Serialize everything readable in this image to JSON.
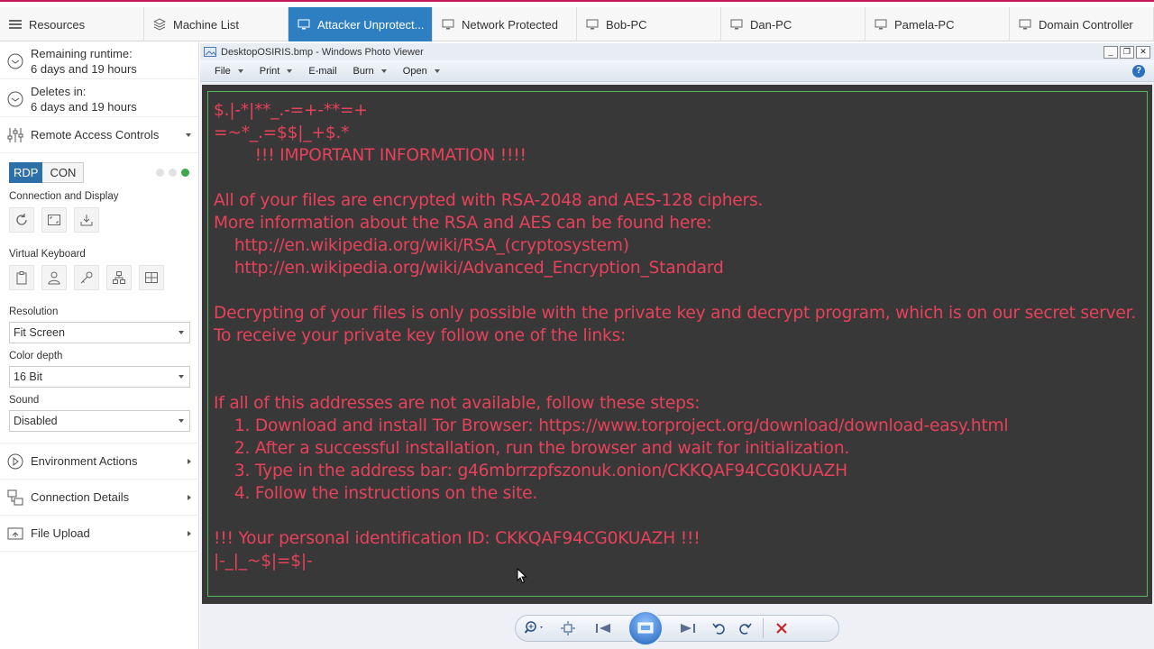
{
  "tabs": [
    {
      "label": "Resources"
    },
    {
      "label": "Machine List"
    },
    {
      "label": "Attacker Unprotect..."
    },
    {
      "label": "Network Protected"
    },
    {
      "label": "Bob-PC"
    },
    {
      "label": "Dan-PC"
    },
    {
      "label": "Pamela-PC"
    },
    {
      "label": "Domain Controller"
    }
  ],
  "sidebar": {
    "remaining_label": "Remaining runtime:",
    "remaining_value": "6 days and 19 hours",
    "deletes_label": "Deletes in:",
    "deletes_value": "6 days and 19 hours",
    "remote_access": "Remote Access Controls",
    "rdp": "RDP",
    "con": "CON",
    "connection_display": "Connection and Display",
    "virtual_keyboard": "Virtual Keyboard",
    "resolution_label": "Resolution",
    "resolution_value": "Fit Screen",
    "color_depth_label": "Color depth",
    "color_depth_value": "16 Bit",
    "sound_label": "Sound",
    "sound_value": "Disabled",
    "environment_actions": "Environment Actions",
    "connection_details": "Connection Details",
    "file_upload": "File Upload"
  },
  "viewer": {
    "title": "DesktopOSIRIS.bmp - Windows Photo Viewer",
    "menu": {
      "file": "File",
      "print": "Print",
      "email": "E-mail",
      "burn": "Burn",
      "open": "Open"
    },
    "help": "?"
  },
  "note": {
    "line1": "$.|-*|**_.-=+-**=+",
    "line2": "=~*_.=$$|_+$.*",
    "line3": "        !!! IMPORTANT INFORMATION !!!!",
    "line4": "",
    "line5": "All of your files are encrypted with RSA-2048 and AES-128 ciphers.",
    "line6": "More information about the RSA and AES can be found here:",
    "line7": "    http://en.wikipedia.org/wiki/RSA_(cryptosystem)",
    "line8": "    http://en.wikipedia.org/wiki/Advanced_Encryption_Standard",
    "line9": "",
    "line10": "Decrypting of your files is only possible with the private key and decrypt program, which is on our secret server.",
    "line11": "To receive your private key follow one of the links:",
    "line12": "",
    "line13": "",
    "line14": "If all of this addresses are not available, follow these steps:",
    "line15": "    1. Download and install Tor Browser: https://www.torproject.org/download/download-easy.html",
    "line16": "    2. After a successful installation, run the browser and wait for initialization.",
    "line17": "    3. Type in the address bar: g46mbrrzpfszonuk.onion/CKKQAF94CG0KUAZH",
    "line18": "    4. Follow the instructions on the site.",
    "line19": "",
    "line20": "!!! Your personal identification ID: CKKQAF94CG0KUAZH !!!",
    "line21": "|-_|_~$|=$|-"
  },
  "colors": {
    "accent": "#2d7fc1",
    "ransom_text": "#e8415a",
    "picture_bg": "#383838",
    "frame": "#5ab65a"
  }
}
